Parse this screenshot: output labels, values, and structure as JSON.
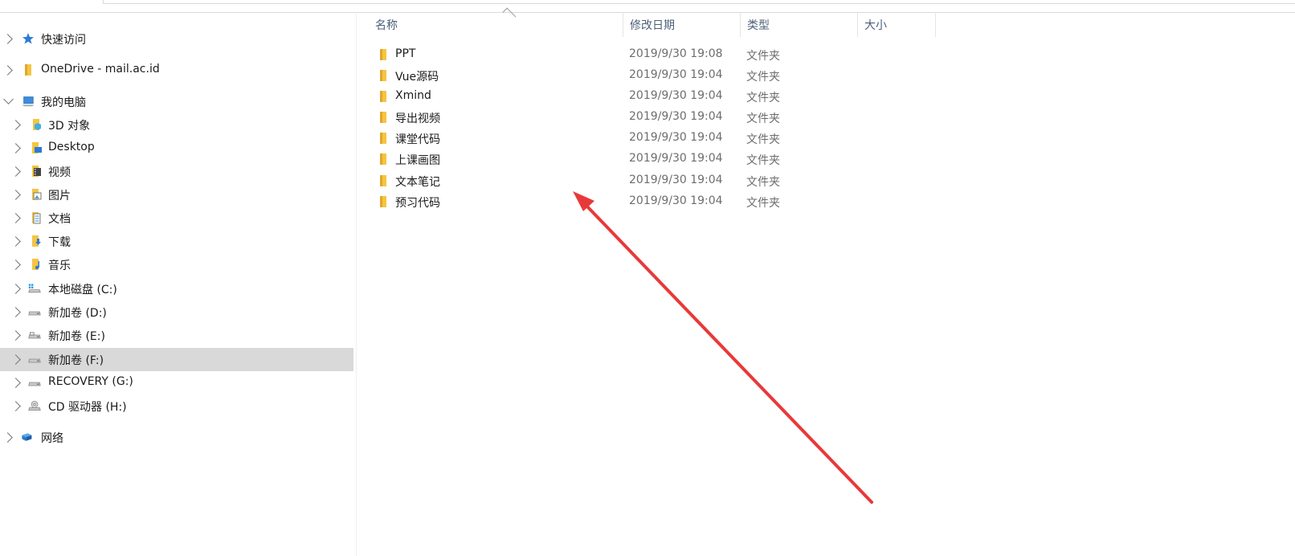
{
  "nav": {
    "items": [
      {
        "label": "快速访问",
        "icon": "star-icon"
      },
      {
        "label": "OneDrive - mail.ac.id",
        "icon": "folder-icon"
      },
      {
        "label": "我的电脑",
        "icon": "computer-icon"
      },
      {
        "label": "3D 对象",
        "icon": "3d-objects-icon"
      },
      {
        "label": "Desktop",
        "icon": "desktop-icon"
      },
      {
        "label": "视频",
        "icon": "video-icon"
      },
      {
        "label": "图片",
        "icon": "pictures-icon"
      },
      {
        "label": "文档",
        "icon": "documents-icon"
      },
      {
        "label": "下载",
        "icon": "download-icon"
      },
      {
        "label": "音乐",
        "icon": "music-icon"
      },
      {
        "label": "本地磁盘 (C:)",
        "icon": "windows-drive-icon"
      },
      {
        "label": "新加卷 (D:)",
        "icon": "drive-icon"
      },
      {
        "label": "新加卷 (E:)",
        "icon": "drive-icon"
      },
      {
        "label": "新加卷 (F:)",
        "icon": "drive-icon"
      },
      {
        "label": "RECOVERY (G:)",
        "icon": "drive-icon"
      },
      {
        "label": "CD 驱动器 (H:)",
        "icon": "cd-drive-icon"
      },
      {
        "label": "网络",
        "icon": "network-icon"
      }
    ],
    "selected": "新加卷 (F:)"
  },
  "columns": {
    "name": "名称",
    "date": "修改日期",
    "type": "类型",
    "size": "大小"
  },
  "files": [
    {
      "name": "PPT",
      "date": "2019/9/30 19:08",
      "type": "文件夹"
    },
    {
      "name": "Vue源码",
      "date": "2019/9/30 19:04",
      "type": "文件夹"
    },
    {
      "name": "Xmind",
      "date": "2019/9/30 19:04",
      "type": "文件夹"
    },
    {
      "name": "导出视频",
      "date": "2019/9/30 19:04",
      "type": "文件夹"
    },
    {
      "name": "课堂代码",
      "date": "2019/9/30 19:04",
      "type": "文件夹"
    },
    {
      "name": "上课画图",
      "date": "2019/9/30 19:04",
      "type": "文件夹"
    },
    {
      "name": "文本笔记",
      "date": "2019/9/30 19:04",
      "type": "文件夹"
    },
    {
      "name": "预习代码",
      "date": "2019/9/30 19:04",
      "type": "文件夹"
    }
  ],
  "colors": {
    "folder": "#f5c542",
    "selected_bg": "#d9d9d9",
    "header_text": "#4c607a",
    "annotation_arrow": "#e8393a"
  }
}
